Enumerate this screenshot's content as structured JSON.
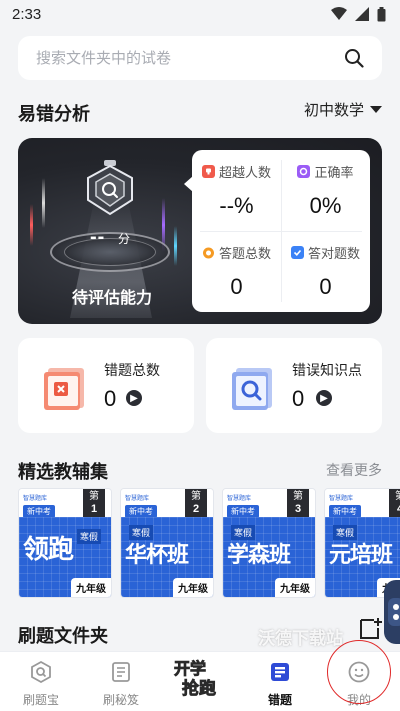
{
  "status_bar": {
    "time": "2:33"
  },
  "search": {
    "placeholder": "搜索文件夹中的试卷"
  },
  "analysis": {
    "title": "易错分析",
    "subject": "初中数学",
    "score_value": "--",
    "score_unit": "分",
    "score_label": "待评估能力",
    "stats": [
      {
        "label": "超越人数",
        "value": "--%",
        "icon": "trophy-icon",
        "color": "#f05a4b"
      },
      {
        "label": "正确率",
        "value": "0%",
        "icon": "target-icon",
        "color": "#9b5cf6"
      },
      {
        "label": "答题总数",
        "value": "0",
        "icon": "clock-icon",
        "color": "#f59a23"
      },
      {
        "label": "答对题数",
        "value": "0",
        "icon": "check-icon",
        "color": "#3b82f6"
      }
    ]
  },
  "summary_cards": [
    {
      "label": "错题总数",
      "value": "0",
      "icon": "wrong-question-icon"
    },
    {
      "label": "错误知识点",
      "value": "0",
      "icon": "knowledge-search-icon"
    }
  ],
  "materials": {
    "title": "精选教辅集",
    "see_more": "查看更多",
    "books": [
      {
        "brand": "智慧题库",
        "tag": "新中考",
        "day_prefix": "第",
        "day": "1",
        "day_suffix": "天",
        "season": "寒假",
        "title": "领跑",
        "grade": "九年级"
      },
      {
        "brand": "智慧题库",
        "tag": "新中考",
        "day_prefix": "第",
        "day": "2",
        "day_suffix": "天",
        "season": "寒假",
        "title": "华杯班",
        "grade": "九年级"
      },
      {
        "brand": "智慧题库",
        "tag": "新中考",
        "day_prefix": "第",
        "day": "3",
        "day_suffix": "天",
        "season": "寒假",
        "title": "学森班",
        "grade": "九年级"
      },
      {
        "brand": "智慧题库",
        "tag": "新中考",
        "day_prefix": "第",
        "day": "4",
        "day_suffix": "天",
        "season": "寒假",
        "title": "元培班",
        "grade": "九年级"
      }
    ]
  },
  "folders": {
    "title": "刷题文件夹",
    "watermark": "沃德下载站"
  },
  "nav": {
    "items": [
      {
        "label": "刷题宝",
        "icon": "search-book-icon"
      },
      {
        "label": "刷秘笈",
        "icon": "notebook-icon"
      },
      {
        "label": "开学抢跑",
        "icon": "promo-logo"
      },
      {
        "label": "错题",
        "icon": "wrong-book-icon"
      },
      {
        "label": "我的",
        "icon": "smiley-icon"
      }
    ],
    "promo_line1": "开学",
    "promo_line2": "抢跑",
    "active_color": "#1f2328"
  }
}
